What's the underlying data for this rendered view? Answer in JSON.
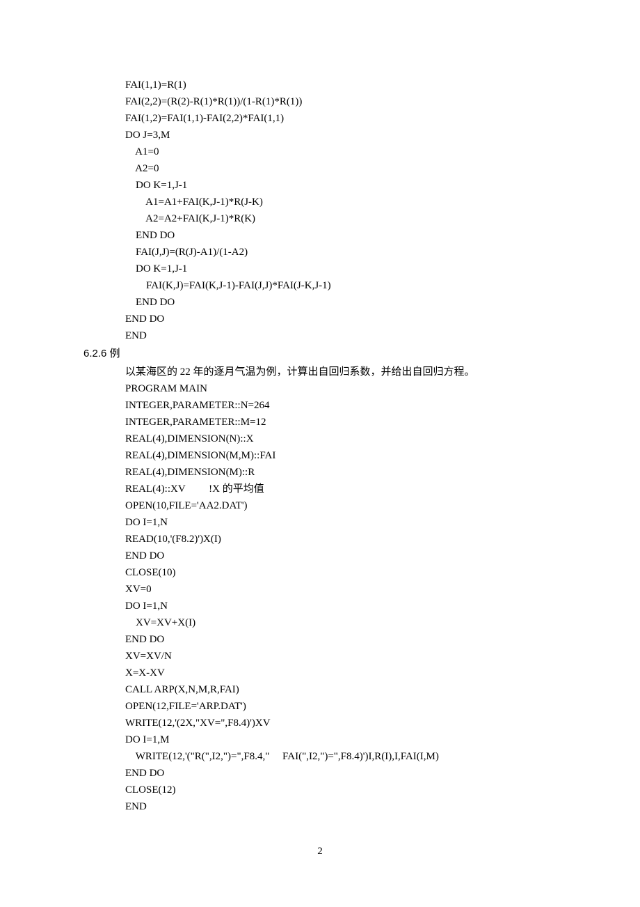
{
  "code_block_1": [
    "FAI(1,1)=R(1)",
    "FAI(2,2)=(R(2)-R(1)*R(1))/(1-R(1)*R(1))",
    "FAI(1,2)=FAI(1,1)-FAI(2,2)*FAI(1,1)",
    "DO J=3,M",
    "    A1=0",
    "    A2=0",
    "    DO K=1,J-1",
    "        A1=A1+FAI(K,J-1)*R(J-K)",
    "        A2=A2+FAI(K,J-1)*R(K)",
    "    END DO",
    "    FAI(J,J)=(R(J)-A1)/(1-A2)",
    "    DO K=1,J-1",
    "        FAI(K,J)=FAI(K,J-1)-FAI(J,J)*FAI(J-K,J-1)",
    "    END DO",
    "END DO",
    "END"
  ],
  "section_heading": "6.2.6 例",
  "example_intro": "以某海区的 22 年的逐月气温为例，计算出自回归系数，并给出自回归方程。",
  "code_block_2": [
    "PROGRAM MAIN",
    "INTEGER,PARAMETER::N=264",
    "INTEGER,PARAMETER::M=12",
    "REAL(4),DIMENSION(N)::X",
    "REAL(4),DIMENSION(M,M)::FAI",
    "REAL(4),DIMENSION(M)::R",
    "REAL(4)::XV         !X 的平均值",
    "OPEN(10,FILE='AA2.DAT')",
    "DO I=1,N",
    "READ(10,'(F8.2)')X(I)",
    "END DO",
    "CLOSE(10)",
    "XV=0",
    "DO I=1,N",
    "    XV=XV+X(I)",
    "END DO",
    "XV=XV/N",
    "X=X-XV",
    "CALL ARP(X,N,M,R,FAI)",
    "OPEN(12,FILE='ARP.DAT')",
    "WRITE(12,'(2X,\"XV=\",F8.4)')XV",
    "DO I=1,M",
    "    WRITE(12,'(\"R(\",I2,\")=\",F8.4,\"     FAI(\",I2,\")=\",F8.4)')I,R(I),I,FAI(I,M)",
    "END DO",
    "CLOSE(12)",
    "END"
  ],
  "page_number": "2"
}
